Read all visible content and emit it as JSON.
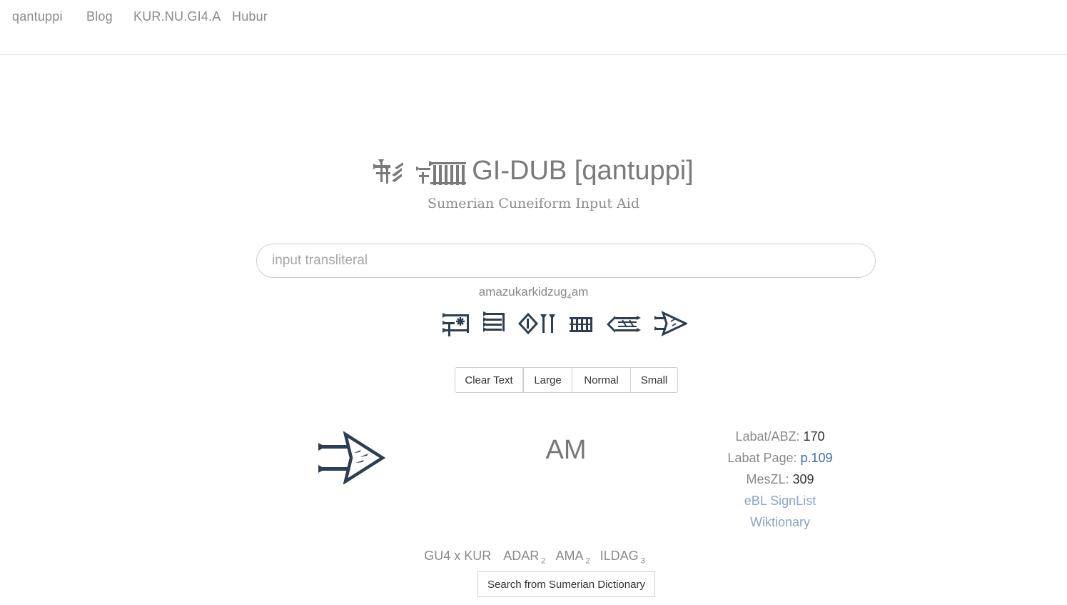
{
  "nav": {
    "items": [
      "qantuppi",
      "Blog",
      "KUR.NU.GI4.A",
      "Hubur"
    ]
  },
  "header": {
    "title": "GI-DUB [qantuppi]",
    "subtitle": "Sumerian Cuneiform Input Aid",
    "title_glyphs": [
      "gi-sign",
      "dub-sign"
    ]
  },
  "search": {
    "placeholder": "input transliteral",
    "value": ""
  },
  "transliteration": {
    "before": "amazukarkidzug",
    "sub": "4",
    "after": "am"
  },
  "cuneiform_row": [
    "ama-sign",
    "zu-sign",
    "kar-sign",
    "ki-sign",
    "dzug-sign",
    "am-sign"
  ],
  "buttons": {
    "clear": "Clear Text",
    "large": "Large",
    "normal": "Normal",
    "small": "Small"
  },
  "sign": {
    "name": "AM",
    "icon": "am-sign",
    "labat_abz_label": "Labat/ABZ: ",
    "labat_abz_value": "170",
    "labat_page_label": "Labat Page: ",
    "labat_page_value": "p.109",
    "meszl_label": "MesZL: ",
    "meszl_value": "309",
    "ebl_link": "eBL SignList",
    "wiktionary_link": "Wiktionary"
  },
  "variants": [
    {
      "base": "GU4 x KUR",
      "sub": ""
    },
    {
      "base": "ADAR",
      "sub": "2"
    },
    {
      "base": "AMA",
      "sub": "2"
    },
    {
      "base": "ILDAG",
      "sub": "3"
    }
  ],
  "dictionary_button": "Search from Sumerian Dictionary",
  "colors": {
    "cuneiform": "#2c3e50",
    "link": "#3a6bb0",
    "muted_text": "#8a8a8a"
  }
}
